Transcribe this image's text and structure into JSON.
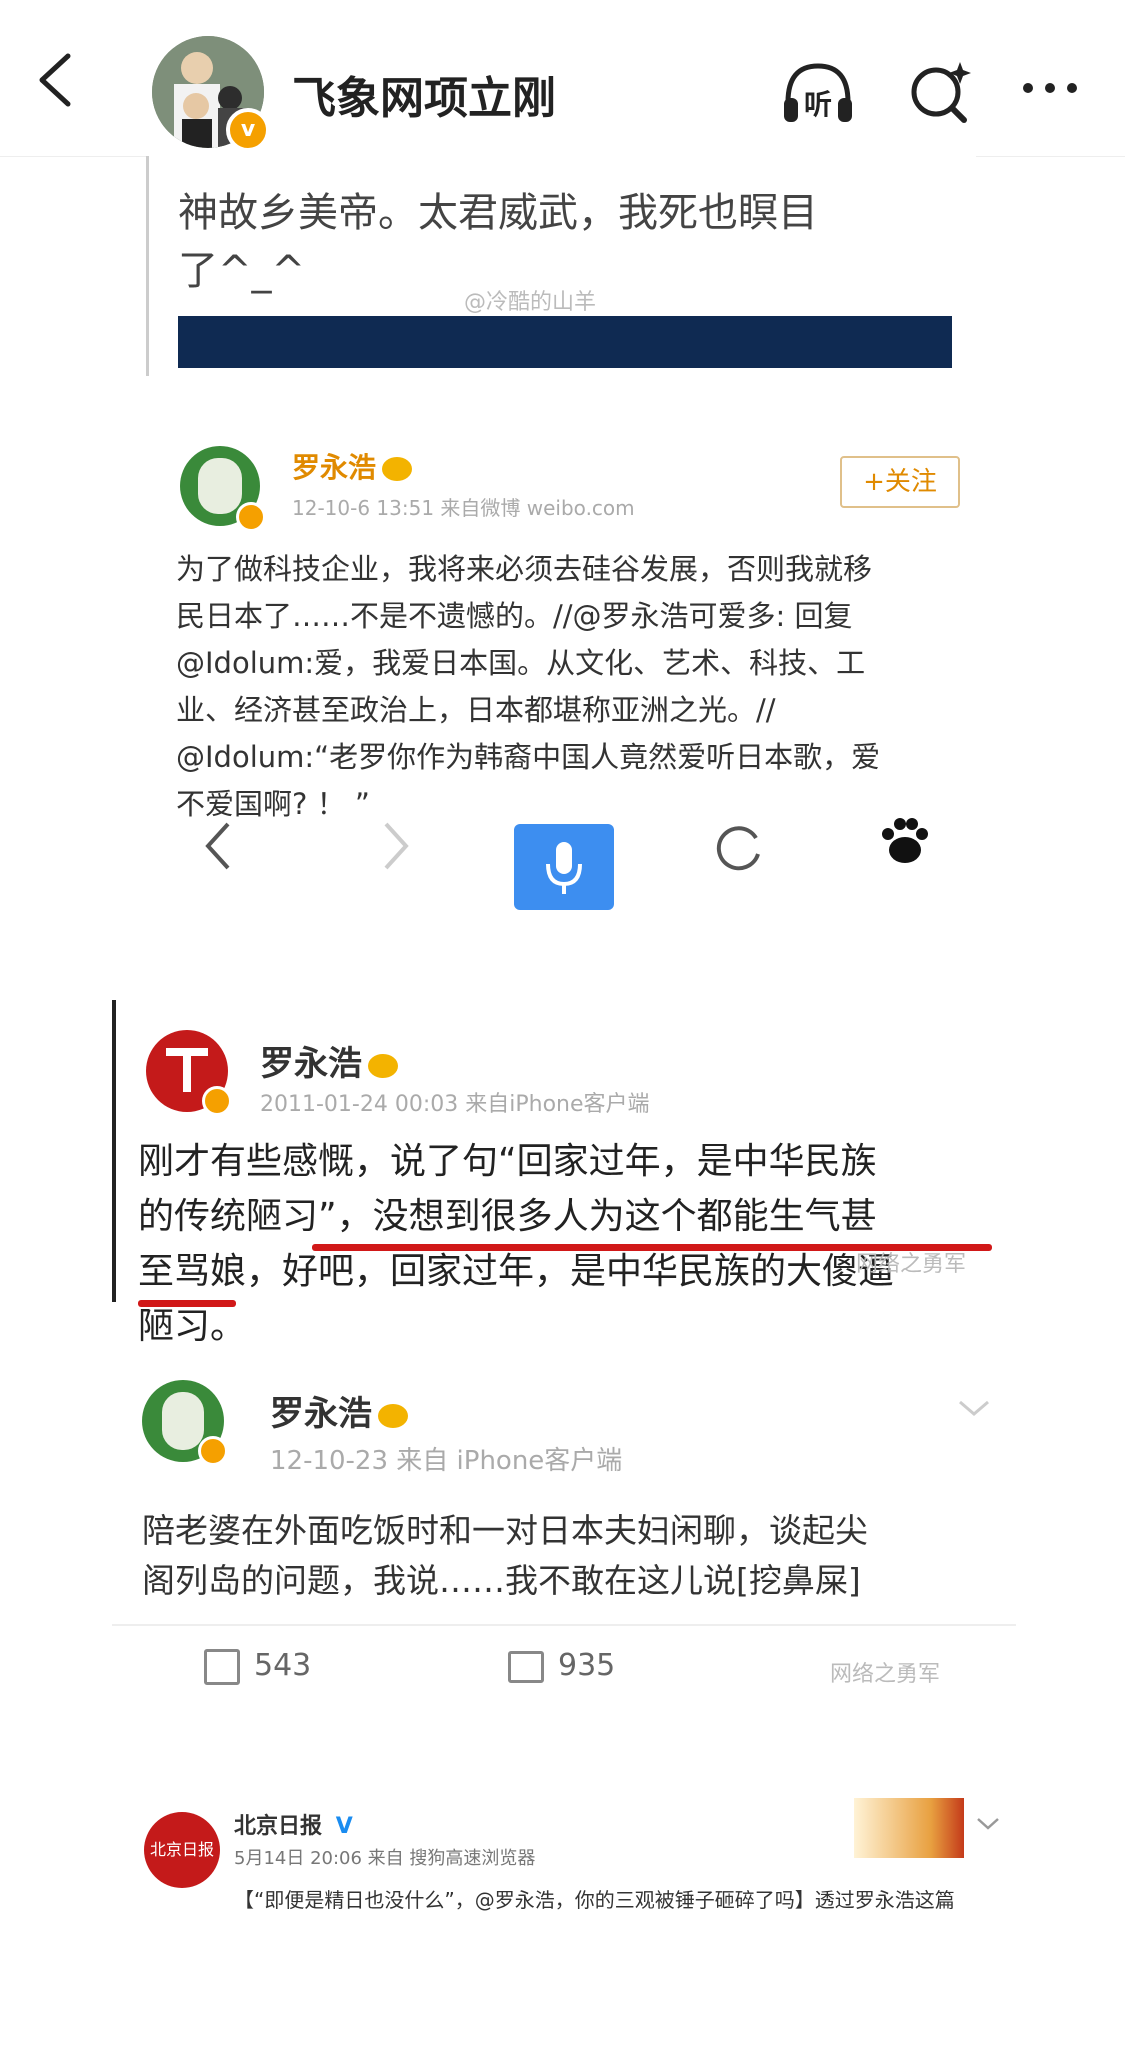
{
  "header": {
    "title": "飞象网项立刚",
    "listen_label": "听"
  },
  "shot1": {
    "text_line1": "神故乡美帝。太君威武，我死也瞑目",
    "text_line2": "了^_^",
    "watermark": "@冷酷的山羊"
  },
  "shot2": {
    "username": "罗永浩",
    "meta": "12-10-6 13:51  来自微博 weibo.com",
    "follow_label": "+关注",
    "text_lines": [
      "为了做科技企业，我将来必须去硅谷发展，否则我就移",
      "民日本了……不是不遗憾的。//@罗永浩可爱多: 回复",
      "@Idolum:爱，我爱日本国。从文化、艺术、科技、工",
      "业、经济甚至政治上，日本都堪称亚洲之光。//",
      "@Idolum:“老罗你作为韩裔中国人竟然爱听日本歌，爱",
      "不爱国啊? ！ ”"
    ]
  },
  "shot3": {
    "username": "罗永浩",
    "meta": "2011-01-24 00:03  来自iPhone客户端",
    "text_lines": [
      "刚才有些感慨，说了句“回家过年，是中华民族",
      "的传统陋习”，没想到很多人为这个都能生气甚",
      "至骂娘，好吧，回家过年，是中华民族的大傻逼",
      "陋习。"
    ],
    "watermark": "网络之勇军"
  },
  "shot4": {
    "username": "罗永浩",
    "meta": "12-10-23  来自 iPhone客户端",
    "text_lines": [
      "陪老婆在外面吃饭时和一对日本夫妇闲聊，谈起尖",
      "阁列岛的问题，我说……我不敢在这儿说[挖鼻屎]"
    ],
    "repost_count": "543",
    "comment_count": "935",
    "watermark": "网络之勇军"
  },
  "shot5": {
    "username": "北京日报",
    "meta": "5月14日 20:06 来自 搜狗高速浏览器",
    "text_line": "【“即便是精日也没什么”，@罗永浩，你的三观被锤子砸碎了吗】透过罗永浩这篇"
  }
}
